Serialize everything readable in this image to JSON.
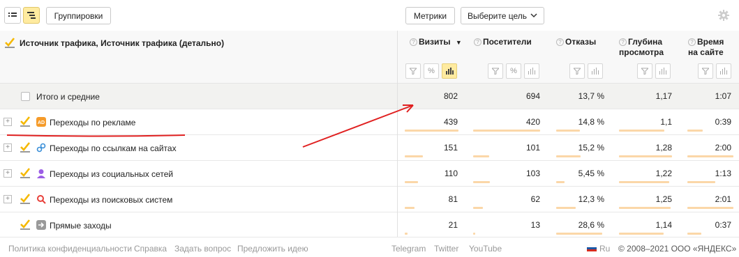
{
  "toolbar": {
    "groupings_label": "Группировки",
    "metrics_label": "Метрики",
    "goal_label": "Выберите цель"
  },
  "header": {
    "dimension_title": "Источник трафика, Источник трафика (детально)",
    "columns": [
      {
        "label": "Визиты",
        "sorted": "desc"
      },
      {
        "label": "Посетители"
      },
      {
        "label": "Отказы"
      },
      {
        "label_line1": "Глубина",
        "label_line2": "просмотра"
      },
      {
        "label_line1": "Время",
        "label_line2": "на сайте"
      }
    ]
  },
  "total": {
    "label": "Итого и средние",
    "visits": "802",
    "visitors": "694",
    "bounce": "13,7 %",
    "depth": "1,17",
    "time": "1:07"
  },
  "rows": [
    {
      "label": "Переходы по рекламе",
      "icon": "ad-icon",
      "visits": "439",
      "visitors": "420",
      "bounce": "14,8 %",
      "depth": "1,1",
      "time": "0:39"
    },
    {
      "label": "Переходы по ссылкам на сайтах",
      "icon": "link-icon",
      "visits": "151",
      "visitors": "101",
      "bounce": "15,2 %",
      "depth": "1,28",
      "time": "2:00"
    },
    {
      "label": "Переходы из социальных сетей",
      "icon": "person-icon",
      "visits": "110",
      "visitors": "103",
      "bounce": "5,45 %",
      "depth": "1,22",
      "time": "1:13"
    },
    {
      "label": "Переходы из поисковых систем",
      "icon": "search-icon",
      "visits": "81",
      "visitors": "62",
      "bounce": "12,3 %",
      "depth": "1,25",
      "time": "2:01"
    },
    {
      "label": "Прямые заходы",
      "icon": "direct-icon",
      "visits": "21",
      "visitors": "13",
      "bounce": "28,6 %",
      "depth": "1,14",
      "time": "0:37"
    }
  ],
  "footer": {
    "privacy": "Политика конфиденциальности",
    "help": "Справка",
    "ask": "Задать вопрос",
    "idea": "Предложить идею",
    "telegram": "Telegram",
    "twitter": "Twitter",
    "youtube": "YouTube",
    "lang": "Ru",
    "copyright": "© 2008–2021 ООО «ЯНДЕКС»"
  },
  "colors": {
    "accent_yellow": "#ffeba0",
    "bar": "#fbd7a8",
    "annotation_red": "#e02020",
    "checkbox": "#f5b800"
  }
}
